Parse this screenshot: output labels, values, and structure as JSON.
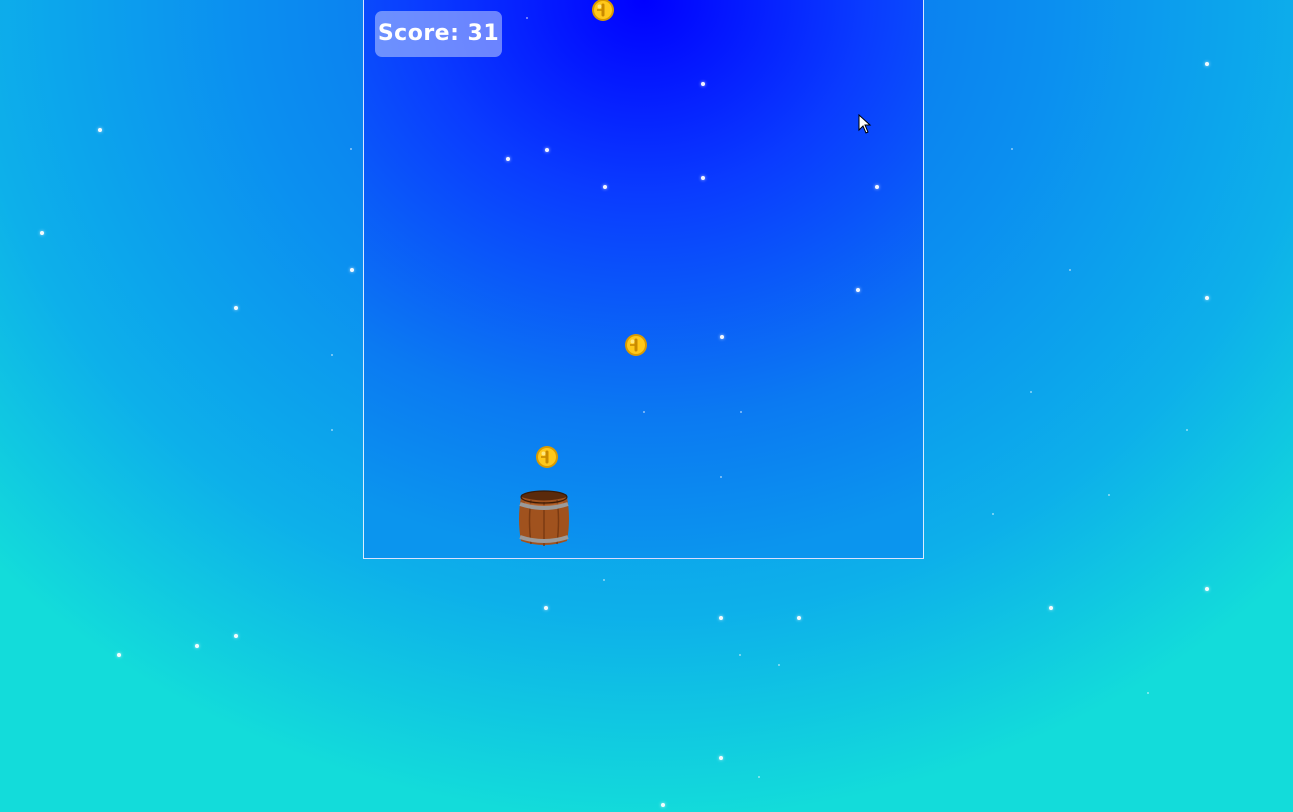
{
  "hud": {
    "score_label": "Score: 31",
    "score": 31
  },
  "sprites": {
    "coin_icon": "gold-coin-icon",
    "coins_visible": 3,
    "player_icon": "wooden-barrel-icon",
    "cursor_icon": "mouse-pointer-icon"
  },
  "colors": {
    "sky_top": "#0000ff",
    "sky_bottom": "#0b95ee",
    "outer_top": "#0a66f0",
    "outer_bottom": "#13dcda",
    "coin_gold": "#f2b400",
    "barrel_wood": "#a0521e",
    "barrel_band": "#9a9a9a"
  }
}
